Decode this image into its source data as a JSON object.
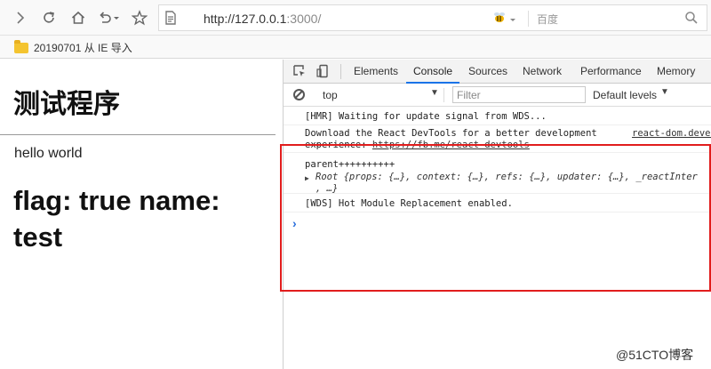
{
  "browser": {
    "url_host": "http://127.0.0.1",
    "url_port": ":3000/",
    "search_engine": "百度",
    "bookmark_folder": "20190701 从 IE 导入"
  },
  "page": {
    "heading": "测试程序",
    "hello": "hello world",
    "flag_line": "flag: true name: test"
  },
  "devtools": {
    "tabs": [
      "Elements",
      "Console",
      "Sources",
      "Network",
      "Performance",
      "Memory"
    ],
    "active_tab": "Console",
    "context": "top",
    "filter_placeholder": "Filter",
    "levels": "Default levels",
    "messages": {
      "hmr": "[HMR] Waiting for update signal from WDS...",
      "devtools_line1": "Download the React DevTools for a better development",
      "devtools_line2_prefix": "experience: ",
      "devtools_link": "https://fb.me/react-devtools",
      "devtools_source": "react-dom.devel",
      "parent": "parent++++++++++",
      "root_obj_line1": "Root {props: {…}, context: {…}, refs: {…}, updater: {…}, _reactInter",
      "root_obj_line2": ", …}",
      "wds": "[WDS] Hot Module Replacement enabled."
    }
  },
  "watermark": "@51CTO博客",
  "colors": {
    "highlight_border": "#e11d1d",
    "active_tab_underline": "#1a73e8",
    "prompt": "#2b6fdc"
  }
}
